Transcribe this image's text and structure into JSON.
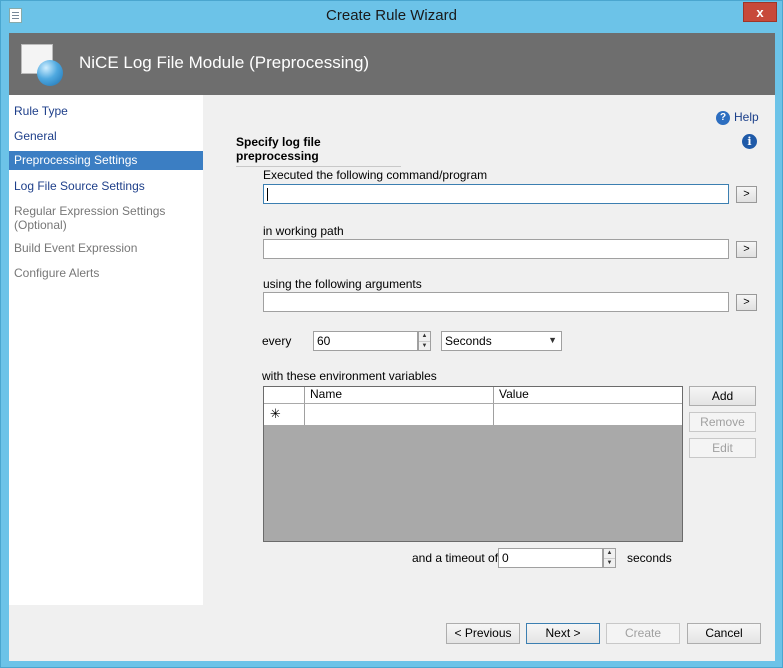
{
  "window": {
    "title": "Create Rule Wizard",
    "close_label": "x"
  },
  "banner": {
    "title": "NiCE Log File Module (Preprocessing)"
  },
  "sidebar": {
    "items": [
      {
        "label": "Rule Type",
        "state": "normal"
      },
      {
        "label": "General",
        "state": "normal"
      },
      {
        "label": "Preprocessing Settings",
        "state": "active"
      },
      {
        "label": "Log File Source Settings",
        "state": "normal"
      },
      {
        "label": "Regular Expression Settings (Optional)",
        "state": "disabled"
      },
      {
        "label": "Build Event Expression",
        "state": "disabled"
      },
      {
        "label": "Configure Alerts",
        "state": "disabled"
      }
    ]
  },
  "main": {
    "help_label": "Help",
    "help_icon": "?",
    "info_icon": "i",
    "section_title": "Specify log file preprocessing",
    "command": {
      "label": "Executed the following command/program",
      "value": "",
      "browse_label": ">"
    },
    "working_path": {
      "label": "in working path",
      "value": "",
      "browse_label": ">"
    },
    "arguments": {
      "label": "using the following arguments",
      "value": "",
      "browse_label": ">"
    },
    "every": {
      "label": "every",
      "value": "60",
      "unit": "Seconds"
    },
    "env": {
      "label": "with these environment variables",
      "columns": [
        "Name",
        "Value"
      ],
      "new_row_marker": "✳",
      "add_label": "Add",
      "remove_label": "Remove",
      "edit_label": "Edit"
    },
    "timeout": {
      "label": "and a timeout of",
      "value": "0",
      "unit": "seconds"
    }
  },
  "footer": {
    "previous_label": "< Previous",
    "next_label": "Next >",
    "create_label": "Create",
    "cancel_label": "Cancel"
  },
  "colors": {
    "window_frame": "#6cc3e8",
    "banner": "#6e6e6e",
    "active_nav": "#3b7ec3",
    "close_button": "#c7493a"
  }
}
